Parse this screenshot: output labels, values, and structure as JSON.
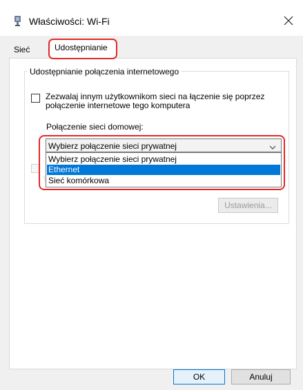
{
  "window": {
    "title": "Właściwości: Wi-Fi"
  },
  "tabs": [
    {
      "label": "Sieć",
      "selected": false
    },
    {
      "label": "Udostępnianie",
      "selected": true
    }
  ],
  "sharing": {
    "group_title": "Udostępnianie połączenia internetowego",
    "allow_checkbox_label": "Zezwalaj innym użytkownikom sieci na łączenie się poprzez połączenie internetowe tego komputera",
    "allow_checked": false,
    "home_connection_label": "Połączenie sieci domowej:",
    "home_connection_selected": "Wybierz połączenie sieci prywatnej",
    "home_connection_options": [
      "Wybierz połączenie sieci prywatnej",
      "Ethernet",
      "Sieć komórkowa"
    ],
    "highlighted_option": "Ethernet",
    "settings_button": "Ustawienia..."
  },
  "footer": {
    "ok": "OK",
    "cancel": "Anuluj"
  },
  "colors": {
    "selection": "#0078d7",
    "annotation_outline": "#e32626",
    "ok_border": "#0078d7"
  },
  "icons": {
    "title": "network-adapter-icon",
    "close": "close-icon",
    "dropdown": "chevron-down-icon"
  }
}
